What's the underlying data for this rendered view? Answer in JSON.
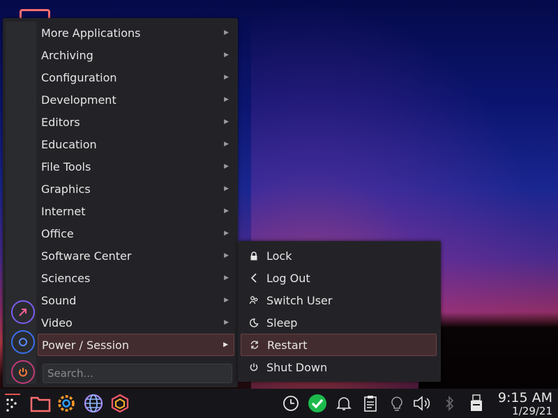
{
  "menu": {
    "categories": [
      {
        "label": "More Applications"
      },
      {
        "label": "Archiving"
      },
      {
        "label": "Configuration"
      },
      {
        "label": "Development"
      },
      {
        "label": "Editors"
      },
      {
        "label": "Education"
      },
      {
        "label": "File Tools"
      },
      {
        "label": "Graphics"
      },
      {
        "label": "Internet"
      },
      {
        "label": "Office"
      },
      {
        "label": "Software Center"
      },
      {
        "label": "Sciences"
      },
      {
        "label": "Sound"
      },
      {
        "label": "Video"
      },
      {
        "label": "Power / Session",
        "active": true
      }
    ],
    "search_placeholder": "Search...",
    "favorites": [
      "external-link-icon",
      "refresh-icon",
      "power-icon"
    ]
  },
  "session_menu": {
    "items": [
      {
        "label": "Lock",
        "icon": "lock-icon"
      },
      {
        "label": "Log Out",
        "icon": "logout-icon"
      },
      {
        "label": "Switch User",
        "icon": "switch-user-icon"
      },
      {
        "label": "Sleep",
        "icon": "sleep-icon"
      },
      {
        "label": "Restart",
        "icon": "restart-icon",
        "active": true
      },
      {
        "label": "Shut Down",
        "icon": "shutdown-icon"
      }
    ]
  },
  "taskbar": {
    "launchers": [
      "app-menu-icon",
      "folder-icon",
      "settings-icon",
      "globe-icon",
      "package-icon"
    ],
    "tray": [
      "clock-icon",
      "update-ok-icon",
      "bell-icon",
      "clipboard-icon",
      "lightbulb-icon",
      "volume-icon",
      "bluetooth-icon",
      "usb-drive-icon"
    ],
    "time": "9:15 AM",
    "date": "1/29/21"
  },
  "colors": {
    "accent_folder": "#ff6e6e",
    "menu_bg": "#232327",
    "active_bg": "#432c2f",
    "check_green": "#1cba4c"
  }
}
